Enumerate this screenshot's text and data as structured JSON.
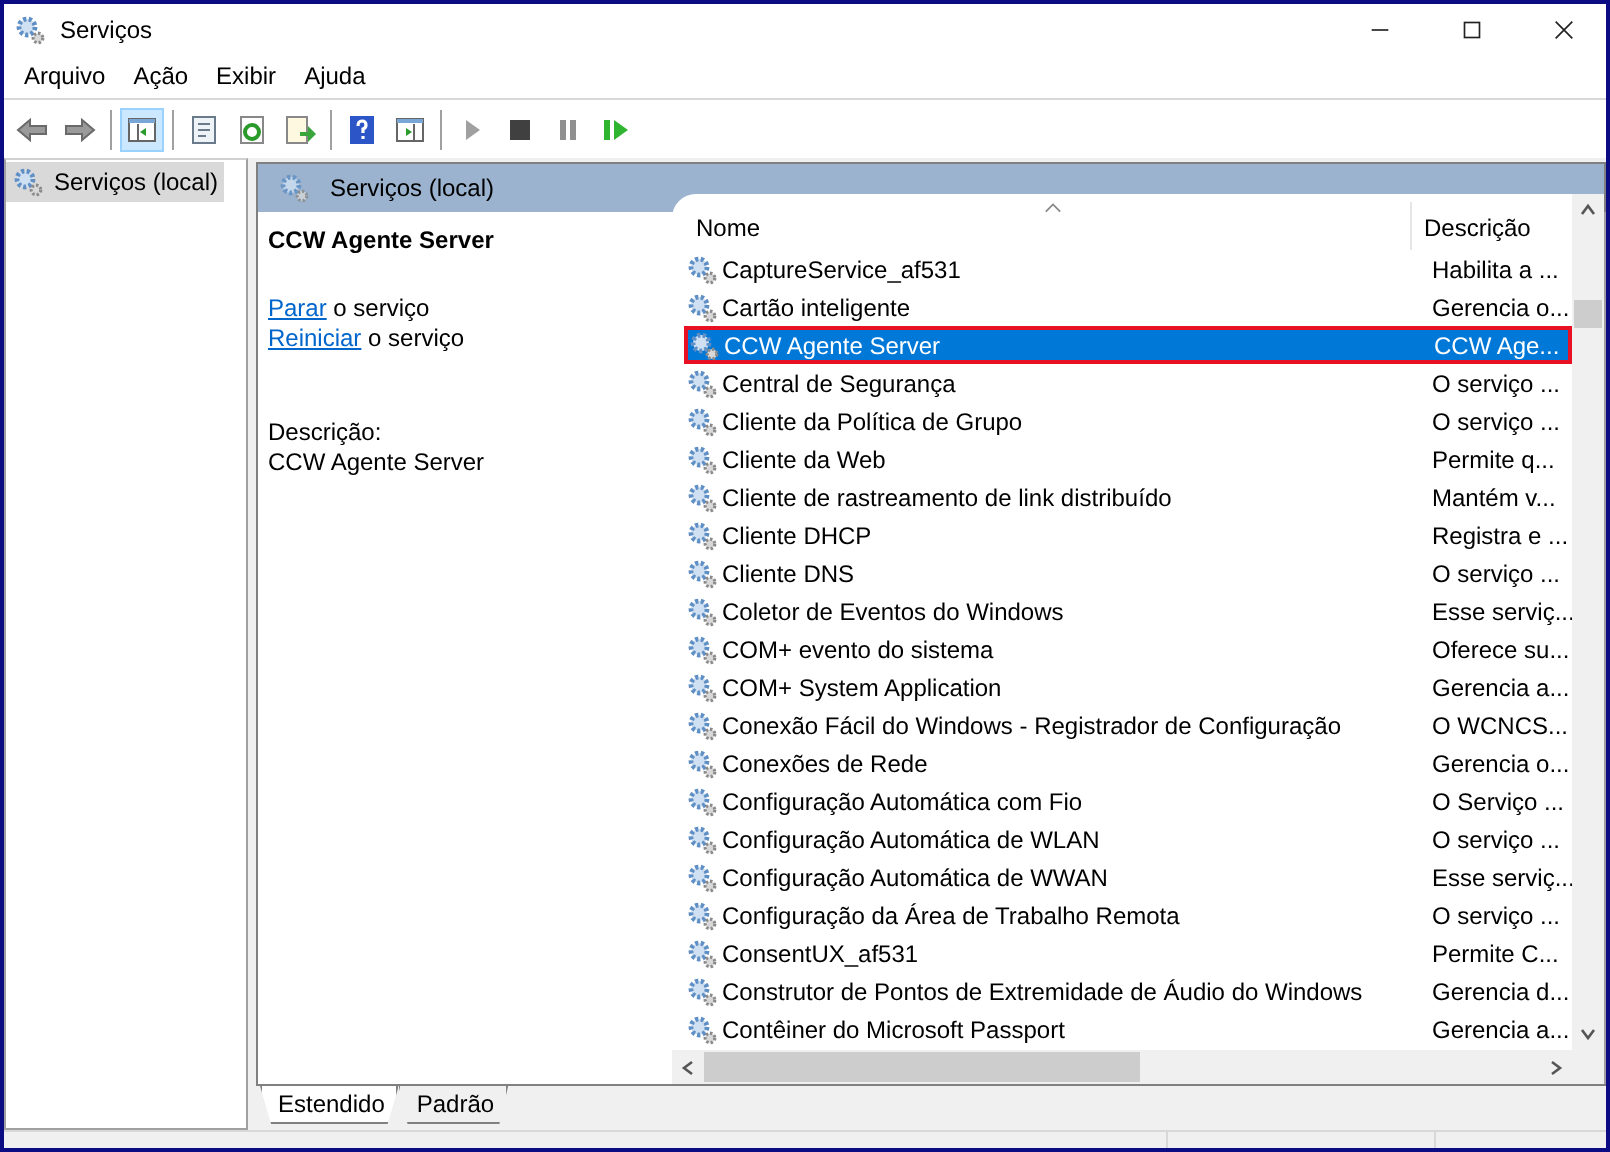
{
  "window": {
    "title": "Serviços"
  },
  "menu": [
    "Arquivo",
    "Ação",
    "Exibir",
    "Ajuda"
  ],
  "toolbar": [
    {
      "kind": "back",
      "selected": false
    },
    {
      "kind": "forward",
      "selected": false
    },
    {
      "kind": "sep"
    },
    {
      "kind": "tree",
      "selected": true
    },
    {
      "kind": "sep"
    },
    {
      "kind": "properties",
      "selected": false
    },
    {
      "kind": "refresh",
      "selected": false
    },
    {
      "kind": "export",
      "selected": false
    },
    {
      "kind": "sep"
    },
    {
      "kind": "help",
      "selected": false
    },
    {
      "kind": "actionpane",
      "selected": false
    },
    {
      "kind": "sep"
    },
    {
      "kind": "play",
      "selected": false
    },
    {
      "kind": "stop",
      "selected": false
    },
    {
      "kind": "pause",
      "selected": false
    },
    {
      "kind": "resume",
      "selected": false
    }
  ],
  "tree": {
    "items": [
      {
        "label": "Serviços (local)",
        "selected": true
      }
    ]
  },
  "pane_header": "Serviços (local)",
  "details": {
    "title": "CCW Agente Server",
    "actions": [
      {
        "link": "Parar",
        "text": "o serviço"
      },
      {
        "link": "Reiniciar",
        "text": "o serviço"
      }
    ],
    "description_label": "Descrição:",
    "description": "CCW Agente Server"
  },
  "table": {
    "columns": [
      "Nome",
      "Descrição"
    ],
    "rows": [
      {
        "name": "CaptureService_af531",
        "description": "Habilita a ...",
        "selected": false
      },
      {
        "name": "Cartão inteligente",
        "description": "Gerencia o...",
        "selected": false
      },
      {
        "name": "CCW Agente Server",
        "description": "CCW Age...",
        "selected": true
      },
      {
        "name": "Central de Segurança",
        "description": "O serviço ...",
        "selected": false
      },
      {
        "name": "Cliente da Política de Grupo",
        "description": "O serviço ...",
        "selected": false
      },
      {
        "name": "Cliente da Web",
        "description": "Permite q...",
        "selected": false
      },
      {
        "name": "Cliente de rastreamento de link distribuído",
        "description": "Mantém v...",
        "selected": false
      },
      {
        "name": "Cliente DHCP",
        "description": "Registra e ...",
        "selected": false
      },
      {
        "name": "Cliente DNS",
        "description": "O serviço ...",
        "selected": false
      },
      {
        "name": "Coletor de Eventos do Windows",
        "description": "Esse serviç...",
        "selected": false
      },
      {
        "name": "COM+ evento do sistema",
        "description": "Oferece su...",
        "selected": false
      },
      {
        "name": "COM+ System Application",
        "description": "Gerencia a...",
        "selected": false
      },
      {
        "name": "Conexão Fácil do Windows - Registrador de Configuração",
        "description": "O WCNCS...",
        "selected": false
      },
      {
        "name": "Conexões de Rede",
        "description": "Gerencia o...",
        "selected": false
      },
      {
        "name": "Configuração Automática com Fio",
        "description": "O Serviço ...",
        "selected": false
      },
      {
        "name": "Configuração Automática de WLAN",
        "description": "O serviço ...",
        "selected": false
      },
      {
        "name": "Configuração Automática de WWAN",
        "description": "Esse serviç...",
        "selected": false
      },
      {
        "name": "Configuração da Área de Trabalho Remota",
        "description": "O serviço ...",
        "selected": false
      },
      {
        "name": "ConsentUX_af531",
        "description": "Permite C...",
        "selected": false
      },
      {
        "name": "Construtor de Pontos de Extremidade de Áudio do Windows",
        "description": "Gerencia d...",
        "selected": false
      },
      {
        "name": "Contêiner do Microsoft Passport",
        "description": "Gerencia a...",
        "selected": false
      }
    ]
  },
  "view_tabs": [
    {
      "label": "Estendido",
      "selected": true
    },
    {
      "label": "Padrão",
      "selected": false
    }
  ]
}
